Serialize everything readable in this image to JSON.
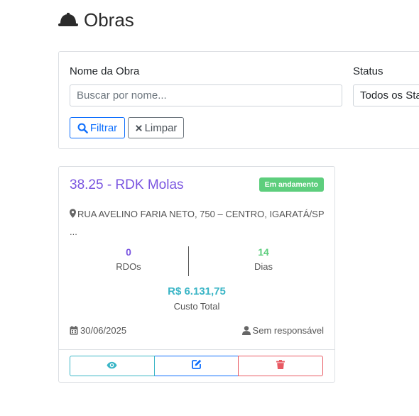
{
  "page": {
    "title": "Obras",
    "header_icon": "hard-hat-icon"
  },
  "filters": {
    "name_label": "Nome da Obra",
    "name_placeholder": "Buscar por nome...",
    "name_value": "",
    "status_label": "Status",
    "status_value": "Todos os Status",
    "filter_button": "Filtrar",
    "clear_button": "Limpar"
  },
  "obra": {
    "title": "38.25 - RDK Molas",
    "status_badge": "Em andamento",
    "address_line1": "RUA AVELINO FARIA NETO, 750 – CENTRO, IGARATÁ/SP",
    "address_line2": "...",
    "rdos_value": "0",
    "rdos_label": "RDOs",
    "days_value": "14",
    "days_label": "Dias",
    "cost_value": "R$ 6.131,75",
    "cost_label": "Custo Total",
    "date": "30/06/2025",
    "responsible": "Sem responsável"
  },
  "colors": {
    "title_purple": "#7a55e0",
    "badge_green": "#5dce7d",
    "days_green": "#5dce7d",
    "cost_cyan": "#3ab5c6",
    "primary_blue": "#0d6efd",
    "danger_red": "#e85a63"
  }
}
